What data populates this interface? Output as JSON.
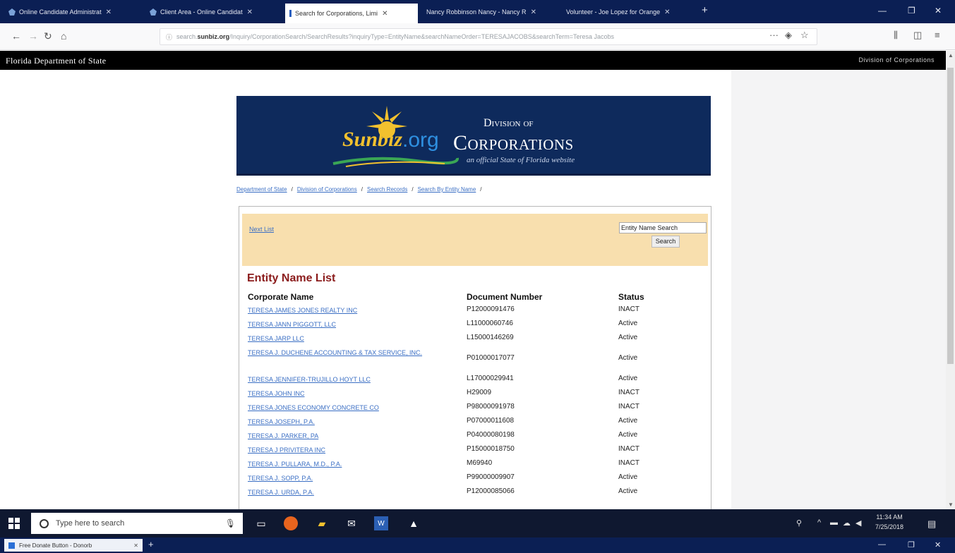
{
  "browser": {
    "tabs": [
      {
        "label": "Online Candidate Administrat",
        "active": false
      },
      {
        "label": "Client Area - Online Candidat",
        "active": false
      },
      {
        "label": "Search for Corporations, Limi",
        "active": true
      },
      {
        "label": "Nancy Robbinson Nancy - Nancy R",
        "active": false
      },
      {
        "label": "Volunteer - Joe Lopez for Orange",
        "active": false
      }
    ],
    "url_prefix": "search.",
    "url_domain": "sunbiz.org",
    "url_path": "/Inquiry/CorporationSearch/SearchResults?inquiryType=EntityName&searchNameOrder=TERESAJACOBS&searchTerm=Teresa Jacobs",
    "close_glyph": "✕",
    "newtab_glyph": "+"
  },
  "site": {
    "dept_title": "Florida Department of State",
    "division_label": "Division of Corporations",
    "logo_sunbiz": "Sunbiz",
    "logo_org": ".org",
    "banner_division_of": "Division of",
    "banner_corporations": "Corporations",
    "banner_tagline": "an official State of Florida website",
    "colors": {
      "banner_bg": "#0e2a5c",
      "panel_bg": "#f8dfae",
      "title_red": "#8b1c1c",
      "link_blue": "#3b6fc4"
    }
  },
  "breadcrumb": [
    "Department of State",
    "Division of Corporations",
    "Search Records",
    "Search By Entity Name"
  ],
  "search": {
    "next_list": "Next List",
    "select_value": "Entity Name Search",
    "button_label": "Search"
  },
  "list": {
    "title": "Entity Name List",
    "headers": {
      "name": "Corporate Name",
      "doc": "Document Number",
      "status": "Status"
    },
    "rows": [
      {
        "name": "TERESA JAMES JONES REALTY INC",
        "doc": "P12000091476",
        "status": "INACT"
      },
      {
        "name": "TERESA JANN PIGGOTT, LLC",
        "doc": "L11000060746",
        "status": "Active"
      },
      {
        "name": "TERESA JARP LLC",
        "doc": "L15000146269",
        "status": "Active"
      },
      {
        "name": "TERESA J. DUCHENE ACCOUNTING & TAX SERVICE, INC.",
        "doc": "P01000017077",
        "status": "Active"
      },
      {
        "name": "TERESA JENNIFER-TRUJILLO HOYT LLC",
        "doc": "L17000029941",
        "status": "Active"
      },
      {
        "name": "TERESA JOHN INC",
        "doc": "H29009",
        "status": "INACT"
      },
      {
        "name": "TERESA JONES ECONOMY CONCRETE CO",
        "doc": "P98000091978",
        "status": "INACT"
      },
      {
        "name": "TERESA JOSEPH, P.A.",
        "doc": "P07000011608",
        "status": "Active"
      },
      {
        "name": "TERESA J. PARKER, PA",
        "doc": "P04000080198",
        "status": "Active"
      },
      {
        "name": "TERESA J PRIVITERA INC",
        "doc": "P15000018750",
        "status": "INACT"
      },
      {
        "name": "TERESA J. PULLARA, M.D., P.A.",
        "doc": "M69940",
        "status": "INACT"
      },
      {
        "name": "TERESA J. SOPP, P.A.",
        "doc": "P99000009907",
        "status": "Active"
      },
      {
        "name": "TERESA J. URDA, P.A.",
        "doc": "P12000085066",
        "status": "Active"
      }
    ]
  },
  "taskbar": {
    "search_placeholder": "Type here to search",
    "time": "11:34 AM",
    "date": "7/25/2018"
  },
  "second_window": {
    "tab_label": "Free Donate Button - Donorb"
  }
}
